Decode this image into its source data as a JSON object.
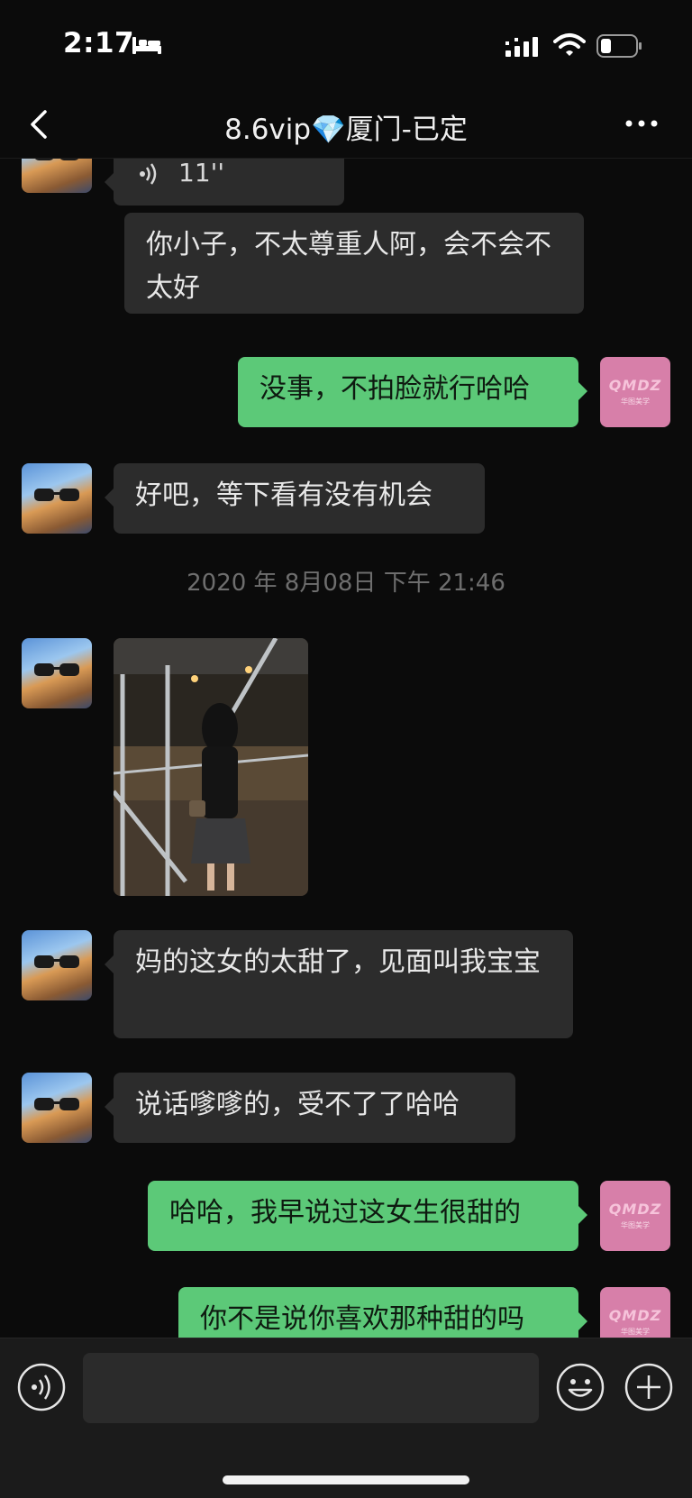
{
  "status_bar": {
    "time": "2:17",
    "icons": [
      "bed-icon",
      "cellular-signal-icon",
      "wifi-icon",
      "battery-icon"
    ]
  },
  "nav": {
    "title": "8.6vip💎厦门-已定",
    "icons": [
      "back-arrow-icon",
      "more-icon"
    ]
  },
  "messages": [
    {
      "side": "in",
      "type": "voice",
      "duration": "11''"
    },
    {
      "side": "in",
      "type": "text",
      "text": "你小子，不太尊重人阿，会不会不太好"
    },
    {
      "side": "out",
      "type": "text",
      "text": "没事，不拍脸就行哈哈"
    },
    {
      "side": "in",
      "type": "text",
      "text": "好吧，等下看有没有机会"
    },
    {
      "type": "timestamp",
      "text": "2020 年 8月08日 下午 21:46"
    },
    {
      "side": "in",
      "type": "image"
    },
    {
      "side": "in",
      "type": "text",
      "text": "妈的这女的太甜了，见面叫我宝宝"
    },
    {
      "side": "in",
      "type": "text",
      "text": "说话嗲嗲的，受不了了哈哈"
    },
    {
      "side": "out",
      "type": "text",
      "text": "哈哈，我早说过这女生很甜的"
    },
    {
      "side": "out",
      "type": "text",
      "text": "你不是说你喜欢那种甜的吗"
    }
  ],
  "avatars": {
    "contact": "cat-with-sunglasses",
    "self_logo_text": "QMDZ",
    "self_logo_sub": "华图美学"
  },
  "input_bar": {
    "placeholder": "",
    "icons": [
      "voice-icon",
      "emoji-icon",
      "add-icon"
    ]
  },
  "colors": {
    "background": "#0b0b0b",
    "incoming_bubble": "#2c2c2c",
    "outgoing_bubble": "#5cc978",
    "timestamp": "#6e6e6e"
  }
}
